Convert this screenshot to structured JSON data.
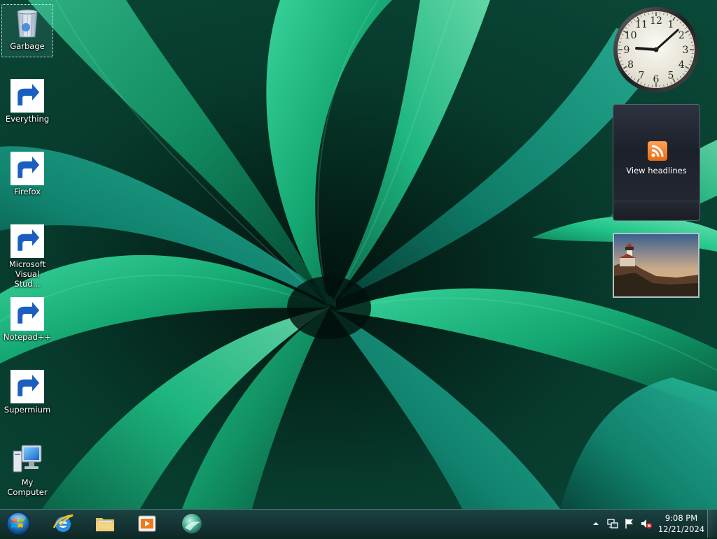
{
  "desktop": {
    "icons": [
      {
        "label": "Garbage",
        "icon": "recycle-bin-icon",
        "selected": true
      },
      {
        "label": "Everything",
        "icon": "everything-search-icon"
      },
      {
        "label": "Firefox",
        "icon": "firefox-icon"
      },
      {
        "label": "Microsoft\nVisual Stud...",
        "icon": "visual-studio-icon"
      },
      {
        "label": "Notepad++",
        "icon": "notepad-plus-plus-icon"
      },
      {
        "label": "Supermium",
        "icon": "supermium-icon"
      },
      {
        "label": "My Computer",
        "icon": "my-computer-icon"
      }
    ]
  },
  "gadgets": {
    "clock": {
      "numerals": [
        "12",
        "1",
        "2",
        "3",
        "4",
        "5",
        "6",
        "7",
        "8",
        "9",
        "10",
        "11"
      ],
      "time": "9:08"
    },
    "headlines": {
      "label": "View headlines",
      "icon": "rss-feed-icon"
    },
    "slideshow": {
      "icon": "lighthouse-photo"
    }
  },
  "taskbar": {
    "start_icon": "windows-start-orb-icon",
    "pinned": [
      {
        "name": "internet-explorer",
        "icon": "internet-explorer-icon"
      },
      {
        "name": "file-explorer",
        "icon": "folder-library-icon"
      },
      {
        "name": "media-player",
        "icon": "media-player-icon"
      },
      {
        "name": "supermium",
        "icon": "supermium-icon"
      }
    ],
    "tray": {
      "icons": [
        "show-hidden-icons-chevron",
        "network-icon",
        "action-center-flag-icon",
        "volume-muted-icon"
      ],
      "time": "9:08 PM",
      "date": "12/21/2024"
    }
  },
  "colors": {
    "wallpaper_dark": "#04221b",
    "leaf_green": "#1db877",
    "leaf_teal": "#1aa39a",
    "taskbar": "#1b4a48"
  }
}
